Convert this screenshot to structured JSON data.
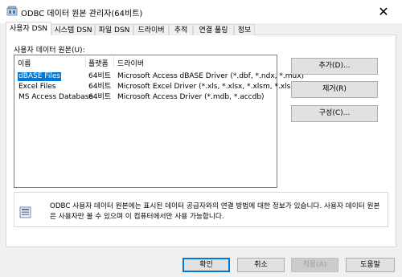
{
  "window": {
    "title": "ODBC 데이터 원본 관리자(64비트)",
    "close_glyph": "✕"
  },
  "tabs": [
    {
      "label": "사용자 DSN",
      "active": true
    },
    {
      "label": "시스템 DSN"
    },
    {
      "label": "파일 DSN"
    },
    {
      "label": "드라이버"
    },
    {
      "label": "추적"
    },
    {
      "label": "연결 풀링"
    },
    {
      "label": "정보"
    }
  ],
  "list": {
    "caption": "사용자 데이터 원본(U):",
    "columns": [
      "이름",
      "플랫폼",
      "드라이버"
    ],
    "rows": [
      {
        "name": "dBASE Files",
        "platform": "64비트",
        "driver": "Microsoft Access dBASE Driver (*.dbf, *.ndx, *.mdx)"
      },
      {
        "name": "Excel Files",
        "platform": "64비트",
        "driver": "Microsoft Excel Driver (*.xls, *.xlsx, *.xlsm, *.xlsb)"
      },
      {
        "name": "MS Access Database",
        "platform": "64비트",
        "driver": "Microsoft Access Driver (*.mdb, *.accdb)"
      }
    ]
  },
  "side_buttons": {
    "add": "추가(D)...",
    "remove": "제거(R)",
    "configure": "구성(C)..."
  },
  "info": {
    "text": "ODBC 사용자 데이터 원본에는 표시된 데이터 공급자와의 연결 방법에 대한 정보가 있습니다. 사용자 데이터 원본은 사용자만 볼 수 있으며 이 컴퓨터에서만 사용 가능합니다."
  },
  "bottom_buttons": {
    "ok": "확인",
    "cancel": "취소",
    "apply": "적용(A)",
    "help": "도움말"
  },
  "colors": {
    "selection": "#0078d7",
    "accent_border": "#0078d7"
  }
}
